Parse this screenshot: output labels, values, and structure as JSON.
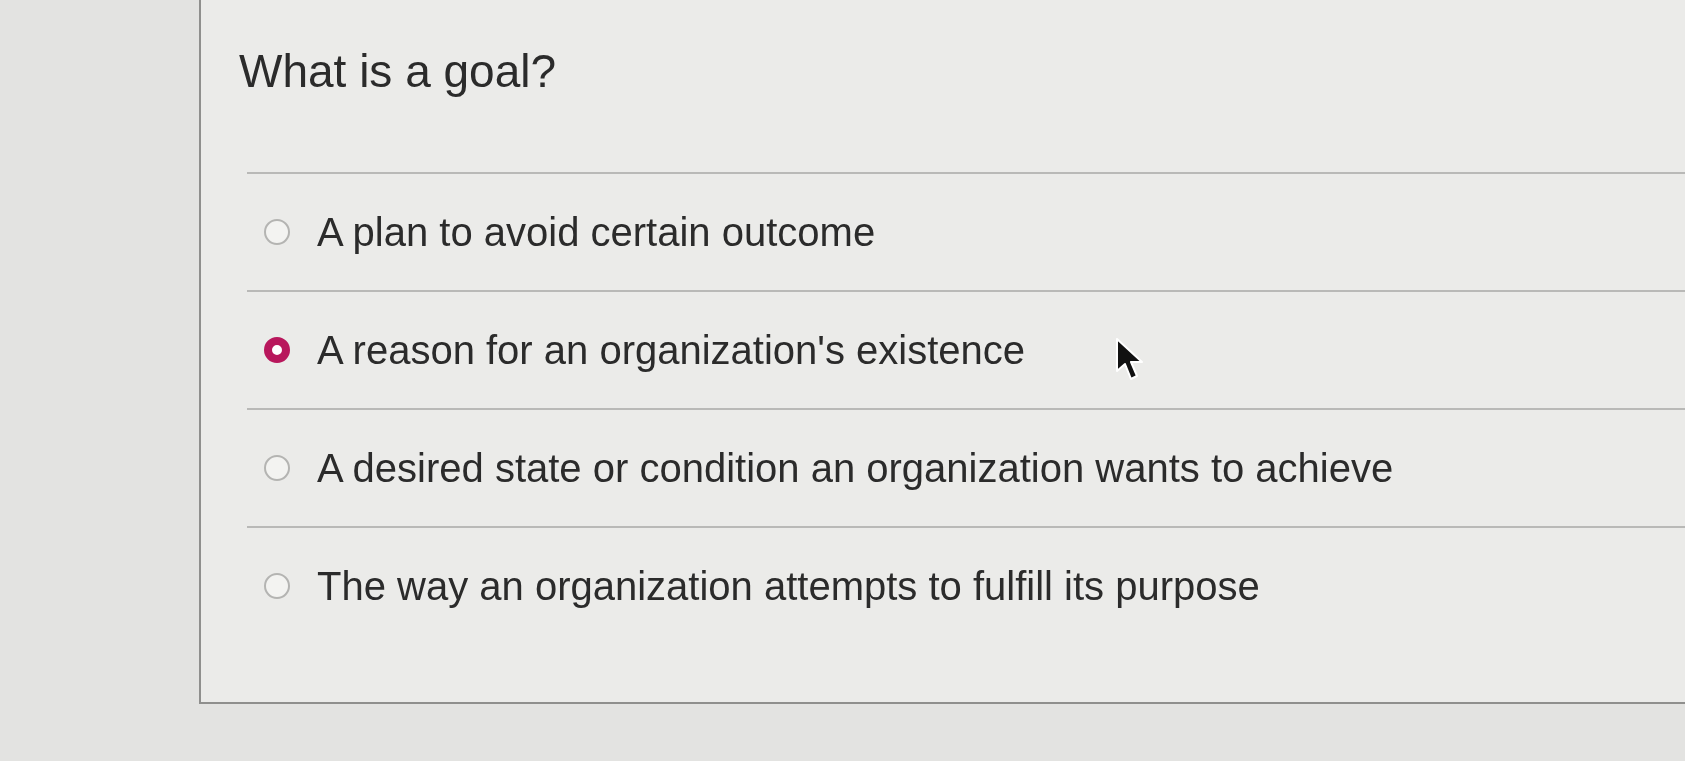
{
  "question": {
    "text": "What is a goal?"
  },
  "options": [
    {
      "label": "A plan to avoid certain outcome",
      "selected": false
    },
    {
      "label": "A reason for an organization's existence",
      "selected": true
    },
    {
      "label": "A desired state or condition an organization wants to achieve",
      "selected": false
    },
    {
      "label": "The way an organization attempts to fulfill its purpose",
      "selected": false
    }
  ]
}
